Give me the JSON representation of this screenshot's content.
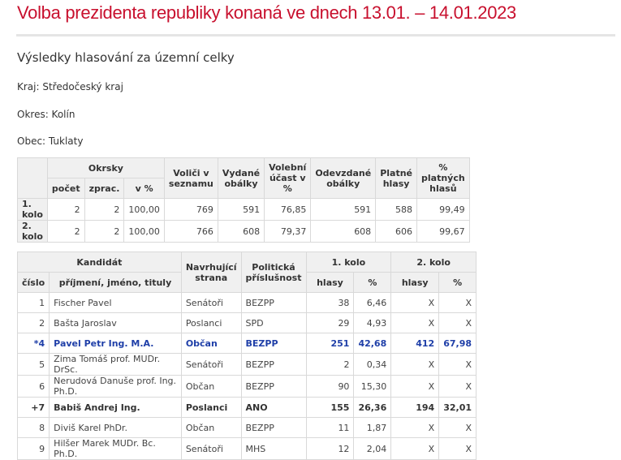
{
  "header": {
    "title": "Volba prezidenta republiky konaná ve dnech 13.01. – 14.01.2023",
    "subtitle": "Výsledky hlasování za územní celky"
  },
  "location": {
    "kraj": "Kraj: Středočeský kraj",
    "okres": "Okres: Kolín",
    "obec": "Obec: Tuklaty"
  },
  "summary": {
    "headers": {
      "okrsky": "Okrsky",
      "pocet": "počet",
      "zprac": "zprac.",
      "pct": "v %",
      "volici": "Voliči v seznamu",
      "vydane": "Vydané obálky",
      "ucast": "Volební účast v %",
      "odevzdane": "Odevzdané obálky",
      "platne": "Platné hlasy",
      "pct_platnych": "% platných hlasů"
    },
    "rows": [
      {
        "label": "1. kolo",
        "pocet": "2",
        "zprac": "2",
        "pct": "100,00",
        "volici": "769",
        "vydane": "591",
        "ucast": "76,85",
        "odevzdane": "591",
        "platne": "588",
        "pct_platnych": "99,49"
      },
      {
        "label": "2. kolo",
        "pocet": "2",
        "zprac": "2",
        "pct": "100,00",
        "volici": "766",
        "vydane": "608",
        "ucast": "79,37",
        "odevzdane": "608",
        "platne": "606",
        "pct_platnych": "99,67"
      }
    ]
  },
  "candidates": {
    "headers": {
      "kandidat": "Kandidát",
      "cislo": "číslo",
      "jmeno": "příjmení, jméno, tituly",
      "strana": "Navrhující strana",
      "prislusnost": "Politická příslušnost",
      "kolo1": "1. kolo",
      "kolo2": "2. kolo",
      "hlasy": "hlasy",
      "pct": "%"
    },
    "rows": [
      {
        "cislo": "1",
        "jmeno": "Fischer Pavel",
        "strana": "Senátoři",
        "prislusnost": "BEZPP",
        "h1": "38",
        "p1": "6,46",
        "h2": "X",
        "p2": "X"
      },
      {
        "cislo": "2",
        "jmeno": "Bašta Jaroslav",
        "strana": "Poslanci",
        "prislusnost": "SPD",
        "h1": "29",
        "p1": "4,93",
        "h2": "X",
        "p2": "X"
      },
      {
        "cislo": "*4",
        "jmeno": "Pavel Petr Ing. M.A.",
        "strana": "Občan",
        "prislusnost": "BEZPP",
        "h1": "251",
        "p1": "42,68",
        "h2": "412",
        "p2": "67,98"
      },
      {
        "cislo": "5",
        "jmeno": "Zima Tomáš prof. MUDr. DrSc.",
        "strana": "Senátoři",
        "prislusnost": "BEZPP",
        "h1": "2",
        "p1": "0,34",
        "h2": "X",
        "p2": "X"
      },
      {
        "cislo": "6",
        "jmeno": "Nerudová Danuše prof. Ing. Ph.D.",
        "strana": "Občan",
        "prislusnost": "BEZPP",
        "h1": "90",
        "p1": "15,30",
        "h2": "X",
        "p2": "X"
      },
      {
        "cislo": "+7",
        "jmeno": "Babiš Andrej Ing.",
        "strana": "Poslanci",
        "prislusnost": "ANO",
        "h1": "155",
        "p1": "26,36",
        "h2": "194",
        "p2": "32,01"
      },
      {
        "cislo": "8",
        "jmeno": "Diviš Karel PhDr.",
        "strana": "Občan",
        "prislusnost": "BEZPP",
        "h1": "11",
        "p1": "1,87",
        "h2": "X",
        "p2": "X"
      },
      {
        "cislo": "9",
        "jmeno": "Hilšer Marek MUDr. Bc. Ph.D.",
        "strana": "Senátoři",
        "prislusnost": "MHS",
        "h1": "12",
        "p1": "2,04",
        "h2": "X",
        "p2": "X"
      }
    ]
  },
  "colors": {
    "title": "#c8102e",
    "winner": "#1f3fa8",
    "header_bg": "#f0f0f0"
  }
}
